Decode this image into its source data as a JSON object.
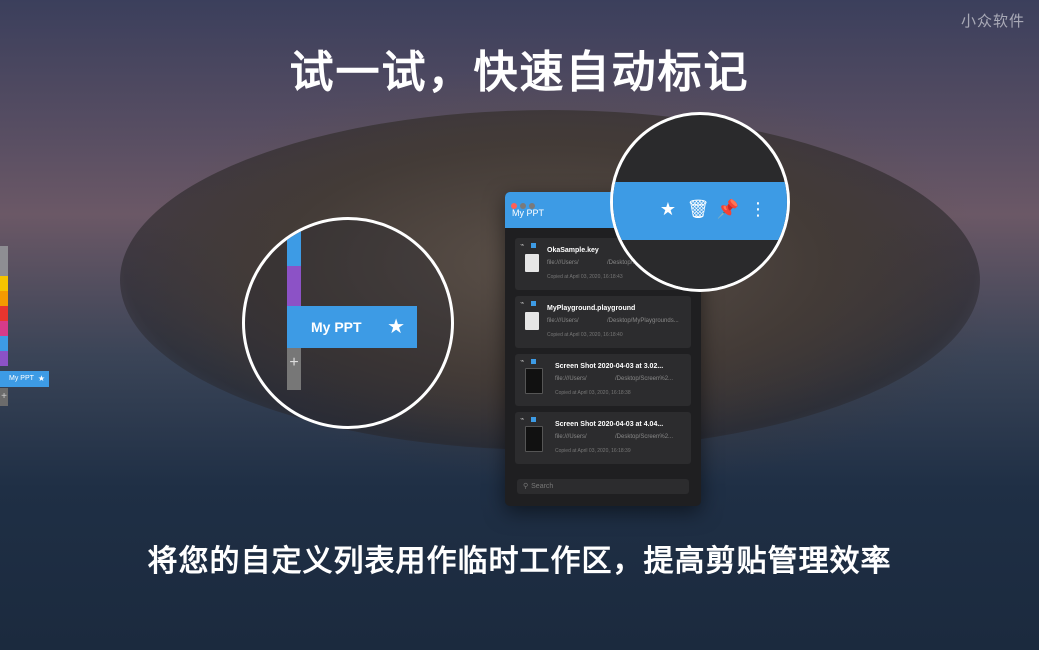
{
  "watermark": "小众软件",
  "headline": "试一试，快速自动标记",
  "subline": "将您的自定义列表用作临时工作区，提高剪贴管理效率",
  "colors": {
    "accent": "#3d9be5",
    "strip": [
      "#8e8e93",
      "#8e8e93",
      "#f5c400",
      "#f49a00",
      "#e8352e",
      "#d63b8a",
      "#3d9be5",
      "#8c52c6"
    ]
  },
  "mini_tab": {
    "label": "My PPT",
    "icon": "star-icon"
  },
  "zoom_left": {
    "tab_label": "My PPT",
    "icon": "star-icon",
    "add_symbol": "+"
  },
  "panel": {
    "title": "My PPT",
    "items": [
      {
        "name": "OkaSample.key",
        "path1": "file:///Users/",
        "path2": "/Desktop/...",
        "copied": "Copied at April 03, 2020, 16:18:43"
      },
      {
        "name": "MyPlayground.playground",
        "path1": "file:///Users/",
        "path2": "/Desktop/MyPlaygrounds...",
        "copied": "Copied at April 03, 2020, 16:18:40"
      },
      {
        "name": "Screen Shot 2020-04-03 at 3.02...",
        "path1": "file:///Users/",
        "path2": "/Desktop/Screen%2...",
        "copied": "Copied at April 03, 2020, 16:18:38"
      },
      {
        "name": "Screen Shot 2020-04-03 at 4.04...",
        "path1": "file:///Users/",
        "path2": "/Desktop/Screen%2...",
        "copied": "Copied at April 03, 2020, 16:18:39"
      }
    ],
    "search_placeholder": "Search"
  },
  "zoom_right": {
    "icons": [
      "star-icon",
      "trash-icon",
      "pin-icon",
      "more-icon"
    ]
  }
}
